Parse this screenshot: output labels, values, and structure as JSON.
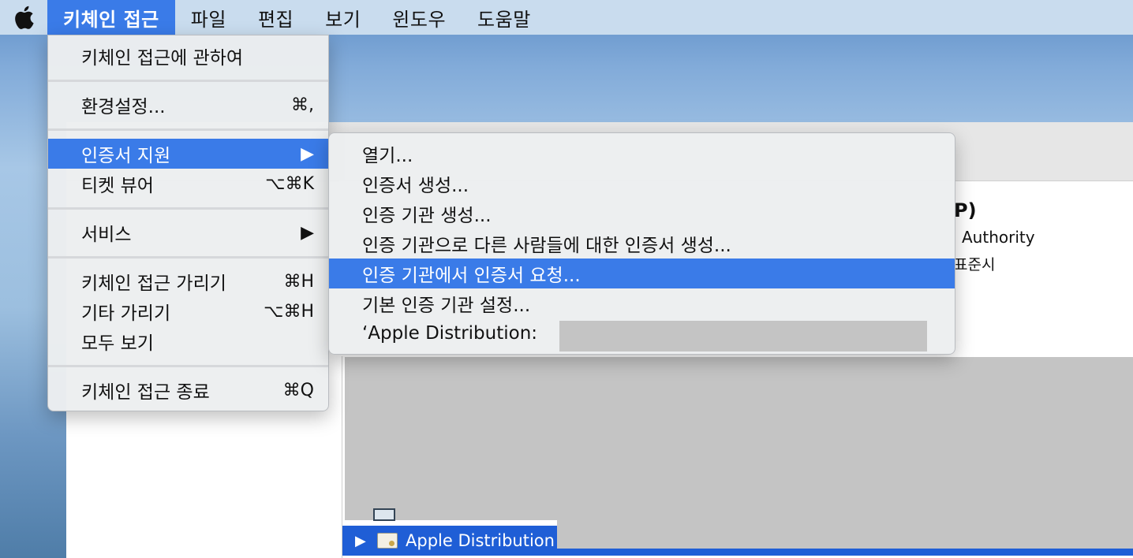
{
  "menubar": {
    "apple_icon": "apple-logo-icon",
    "items": [
      "키체인 접근",
      "파일",
      "편집",
      "보기",
      "윈도우",
      "도움말"
    ]
  },
  "main_menu": {
    "about": "키체인 접근에 관하여",
    "preferences": "환경설정...",
    "preferences_shortcut": "⌘,",
    "cert_assistant": "인증서 지원",
    "cert_assistant_arrow": "▶",
    "ticket_viewer": "티켓 뷰어",
    "ticket_viewer_shortcut": "⌥⌘K",
    "services": "서비스",
    "services_arrow": "▶",
    "hide": "키체인 접근 가리기",
    "hide_shortcut": "⌘H",
    "hide_others": "기타 가리기",
    "hide_others_shortcut": "⌥⌘H",
    "show_all": "모두 보기",
    "quit": "키체인 접근 종료",
    "quit_shortcut": "⌘Q"
  },
  "sub_menu": {
    "items": [
      "열기...",
      "인증서 생성...",
      "인증 기관 생성...",
      "인증 기관으로 다른 사람들에 대한 인증서 생성...",
      "인증 기관에서 인증서 요청...",
      "기본 인증 기관 설정...",
      "‘Apple Distribution:"
    ]
  },
  "background": {
    "title_fragment": "P)",
    "authority_fragment": "Authority",
    "time_fragment": "표준시",
    "selected_row_arrow": "▶",
    "selected_row_label": "Apple Distribution"
  }
}
